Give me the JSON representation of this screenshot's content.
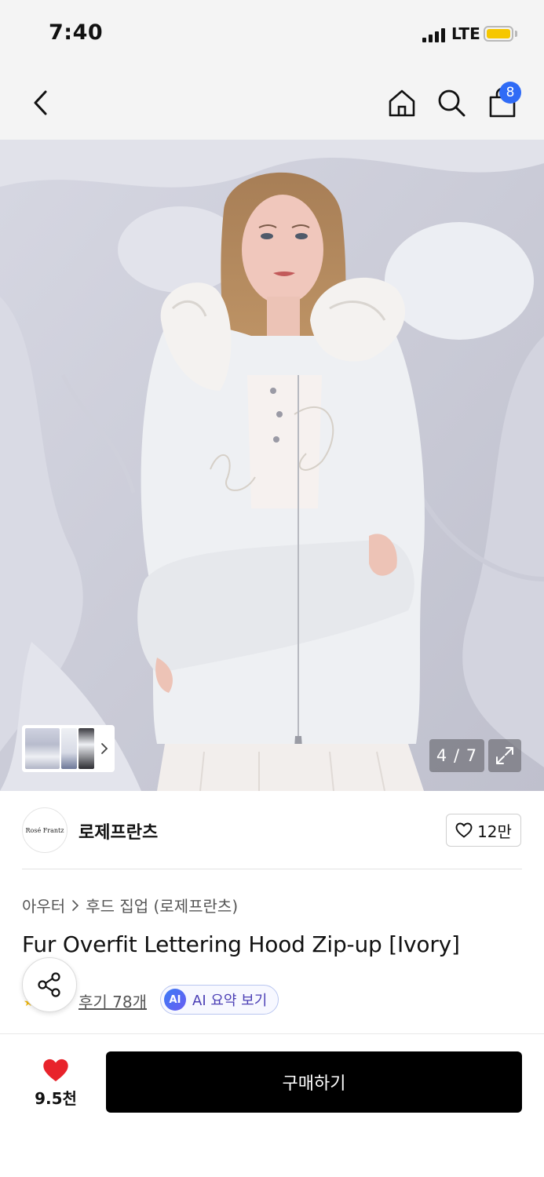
{
  "status": {
    "time": "7:40",
    "network": "LTE"
  },
  "nav": {
    "cart_count": "8"
  },
  "gallery": {
    "counter": "4 / 7"
  },
  "brand": {
    "name": "로제프란츠",
    "logo_text": "Rosé Frantz",
    "likes": "12만"
  },
  "breadcrumb": {
    "category": "아우터",
    "subcategory": "후드 집업 (로제프란츠)"
  },
  "product": {
    "title": "Fur Overfit Lettering Hood Zip-up [Ivory]"
  },
  "reviews": {
    "link": "후기 78개",
    "ai_badge": "AI",
    "ai_label": "AI 요약 보기"
  },
  "bottom": {
    "wish_count": "9.5천",
    "buy_label": "구매하기"
  },
  "colors": {
    "accent_blue": "#2f6bf6",
    "heart_red": "#e8232b",
    "buy_bg": "#000000"
  }
}
